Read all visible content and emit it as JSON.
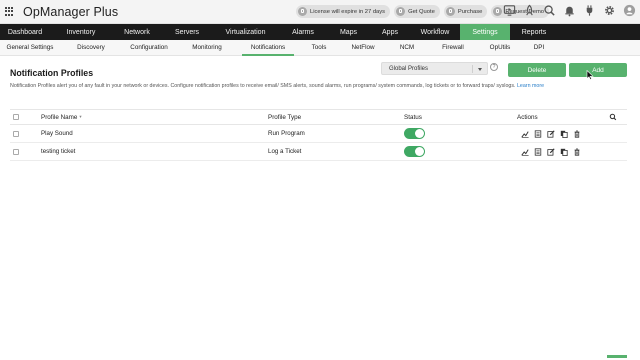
{
  "app": {
    "title": "OpManager Plus"
  },
  "top_bar": {
    "pills": [
      {
        "label": "License will expire in 27 days"
      },
      {
        "label": "Get Quote"
      },
      {
        "label": "Purchase"
      },
      {
        "label": "Request Demo"
      }
    ],
    "icons": [
      "monitor-play-icon",
      "rocket-icon",
      "search-icon",
      "bell-icon",
      "plug-icon",
      "gear-icon",
      "user-avatar-icon"
    ]
  },
  "main_nav": [
    "Dashboard",
    "Inventory",
    "Network",
    "Servers",
    "Virtualization",
    "Alarms",
    "Maps",
    "Apps",
    "Workflow",
    "Settings",
    "Reports"
  ],
  "main_nav_active": "Settings",
  "sub_nav": [
    "General Settings",
    "Discovery",
    "Configuration",
    "Monitoring",
    "Notifications",
    "Tools",
    "NetFlow",
    "NCM",
    "Firewall",
    "OpUtils",
    "DPI"
  ],
  "sub_nav_active": "Notifications",
  "page": {
    "title": "Notification Profiles",
    "description": "Notification Profiles alert you of any fault in your network or devices. Configure notification profiles to receive email/ SMS alerts, sound alarms, run programs/ system commands, log tickets or to forward traps/ syslogs.",
    "learn_more": "Learn more",
    "profile_filter": "Global Profiles",
    "help": "?",
    "delete_label": "Delete",
    "add_label": "Add"
  },
  "table": {
    "headers": {
      "name": "Profile Name",
      "type": "Profile Type",
      "status": "Status",
      "actions": "Actions"
    },
    "rows": [
      {
        "name": "Play Sound",
        "type": "Run Program",
        "status_on": true
      },
      {
        "name": "testing ticket",
        "type": "Log a Ticket",
        "status_on": true
      }
    ],
    "action_icons": [
      "chart-icon",
      "copy-icon",
      "edit-icon",
      "duplicate-icon",
      "delete-icon"
    ]
  },
  "colors": {
    "accent": "#58b26e",
    "nav_bg": "#1b1b1b",
    "toggle_on": "#3fa863",
    "link": "#2a7fc9"
  }
}
